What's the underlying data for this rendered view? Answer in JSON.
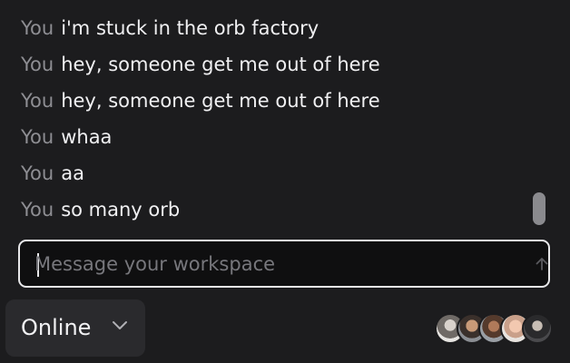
{
  "messages": [
    {
      "sender": "You",
      "text": "i'm stuck in the orb factory"
    },
    {
      "sender": "You",
      "text": "hey, someone get me out of here"
    },
    {
      "sender": "You",
      "text": "hey, someone get me out of here"
    },
    {
      "sender": "You",
      "text": "whaa"
    },
    {
      "sender": "You",
      "text": "aa"
    },
    {
      "sender": "You",
      "text": "so many orb"
    }
  ],
  "composer": {
    "placeholder": "Message your workspace",
    "value": "",
    "send_icon": "arrow-up-icon"
  },
  "status": {
    "label": "Online",
    "chevron_icon": "chevron-down-icon"
  },
  "presence": {
    "avatar_count": 5
  },
  "colors": {
    "background": "#1c1c1e",
    "input_background": "#0f0f10",
    "input_border": "#e8e8ea",
    "sender_text": "#8e8e93",
    "message_text": "#f0f0f2",
    "status_button": "#2a2a2d"
  }
}
